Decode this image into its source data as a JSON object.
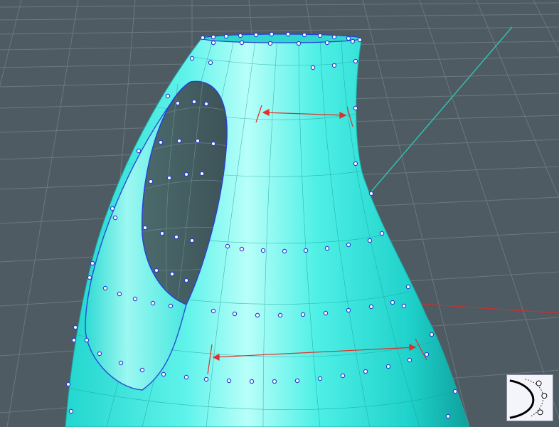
{
  "viewport": {
    "background_color": "#4e5b62",
    "grid_color": "#6b787f",
    "axis_colors": {
      "y_axis": "#2ec4b6",
      "x_axis": "#c83232"
    }
  },
  "model": {
    "surface_color": "#33e8e0",
    "highlight_color": "#b8fff9",
    "edge_color": "#2a3fd6",
    "control_point_color": "#ffffff"
  },
  "annotations": {
    "dimension_color": "#e0302a"
  },
  "nav_widget": {
    "icon": "curve-edit-icon"
  }
}
